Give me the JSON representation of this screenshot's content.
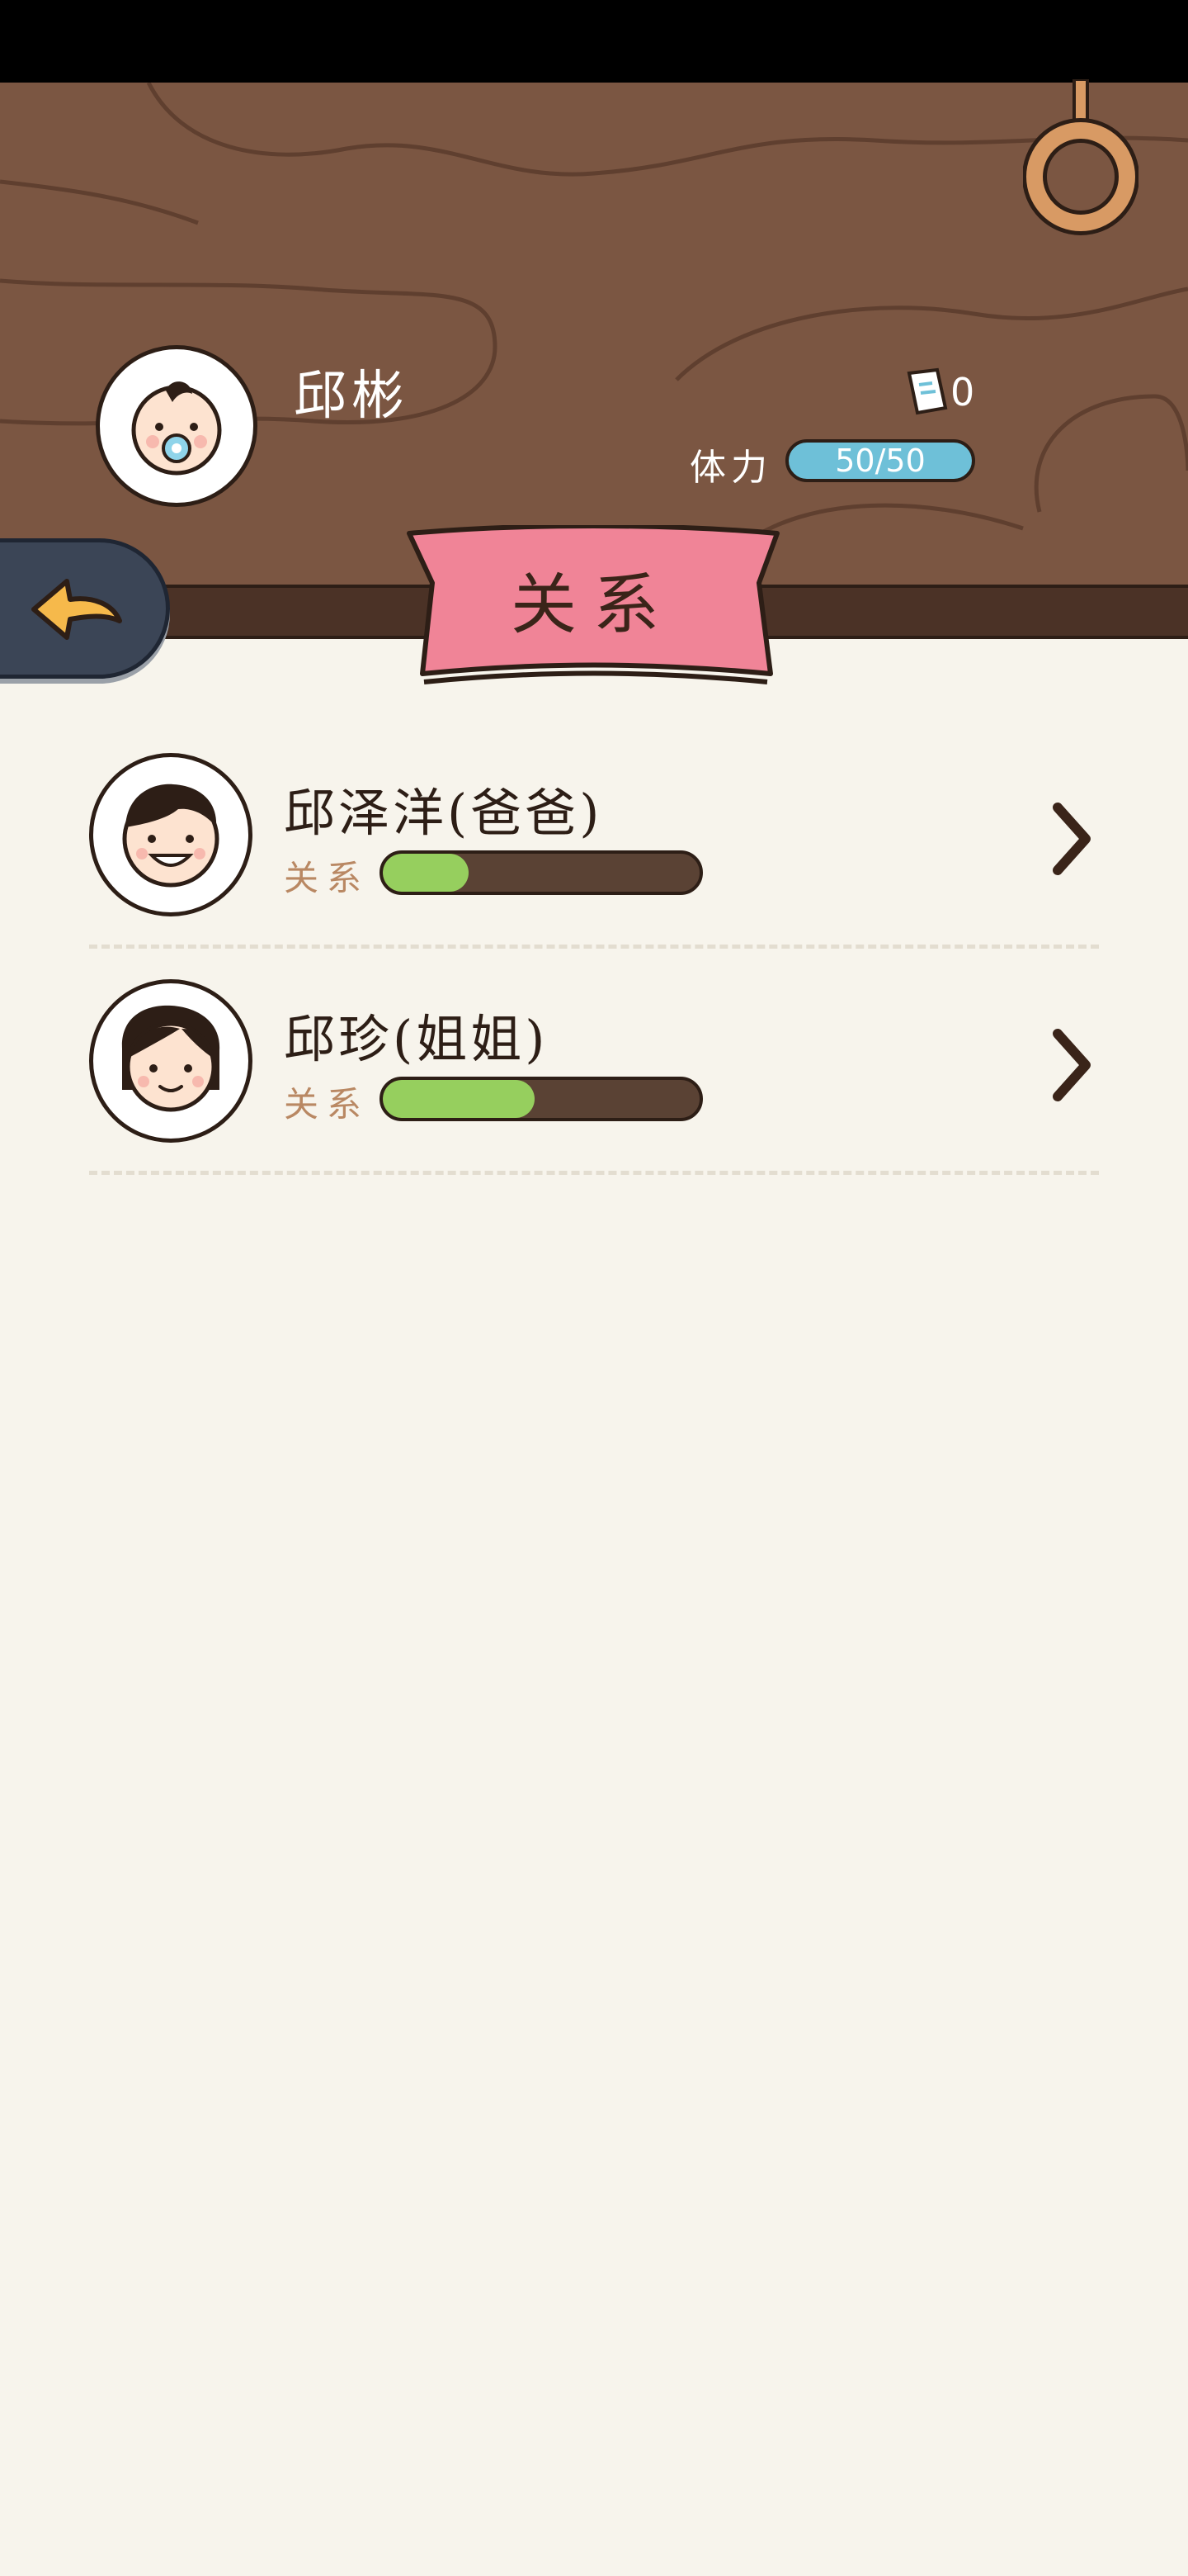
{
  "header": {
    "player_name": "邱彬",
    "ticket_count": "0",
    "stamina_label": "体力",
    "stamina_value": "50/50",
    "tab_title": "关系"
  },
  "icons": {
    "back": "back-arrow-icon",
    "ticket": "ticket-icon",
    "ring": "ring-hook-icon",
    "chevron": "chevron-right-icon"
  },
  "relations": [
    {
      "name": "邱泽洋(爸爸)",
      "label": "关系",
      "level": 0.27
    },
    {
      "name": "邱珍(姐姐)",
      "label": "关系",
      "level": 0.48
    }
  ],
  "colors": {
    "wood": "#7b5642",
    "banner": "#f08497",
    "stamina": "#6ec0d8",
    "relation_fill": "#96cf5e",
    "background": "#f7f4ec"
  }
}
